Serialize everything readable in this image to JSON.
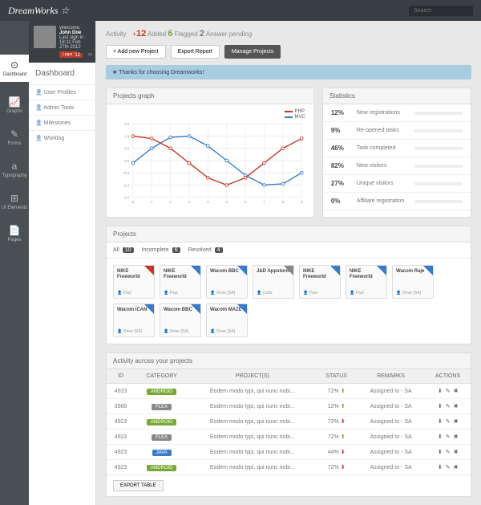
{
  "header": {
    "logo": "DreamWorks ☆",
    "search_placeholder": "Search"
  },
  "user": {
    "welcome": "Welcome,",
    "name": "John Doe",
    "last_signin": "Last sign in : 18:11 Feb 27th 2012",
    "logout": "Logout",
    "badge": "12"
  },
  "nav": [
    {
      "icon": "⊙",
      "label": "Dashboard"
    },
    {
      "icon": "📈",
      "label": "Graphs"
    },
    {
      "icon": "✎",
      "label": "Forms"
    },
    {
      "icon": "a",
      "label": "Typography"
    },
    {
      "icon": "⊞",
      "label": "UI Elements"
    },
    {
      "icon": "📄",
      "label": "Pages"
    }
  ],
  "menu": {
    "title": "Dashboard",
    "items": [
      "User Profiles",
      "Admin Tools",
      "Milestones",
      "Worklog"
    ]
  },
  "activity": {
    "label": "Activity",
    "stats": [
      {
        "prefix": "+",
        "num": "12",
        "text": "Added",
        "cls": "c-red"
      },
      {
        "prefix": "",
        "num": "6",
        "text": "Flagged",
        "cls": "c-green"
      },
      {
        "prefix": "",
        "num": "2",
        "text": "Answer pending",
        "cls": "c-gray"
      }
    ]
  },
  "buttons": {
    "add": "+  Add new Project",
    "export": "Export Report",
    "manage": "Manage Projects"
  },
  "notice": "★  Thanks for choosing Dreamworks!",
  "chart": {
    "title": "Projects graph",
    "legend": [
      {
        "name": "PHP",
        "color": "#c0392b"
      },
      {
        "name": "MVC",
        "color": "#3a7bc8"
      }
    ]
  },
  "chart_data": {
    "type": "line",
    "x": [
      0,
      1,
      2,
      3,
      4,
      5,
      6,
      7,
      8,
      9
    ],
    "ylim": [
      -1.5,
      1.5
    ],
    "series": [
      {
        "name": "MVC",
        "color": "#3a7bc8",
        "values": [
          -0.1,
          0.5,
          0.95,
          1.0,
          0.6,
          0.0,
          -0.6,
          -1.0,
          -0.95,
          -0.5
        ]
      },
      {
        "name": "PHP",
        "color": "#c0392b",
        "values": [
          1.0,
          0.9,
          0.5,
          -0.1,
          -0.7,
          -1.0,
          -0.7,
          -0.1,
          0.5,
          0.9
        ]
      }
    ]
  },
  "stats": {
    "title": "Statistics",
    "rows": [
      {
        "pct": "12%",
        "label": "New registrations",
        "val": 12
      },
      {
        "pct": "9%",
        "label": "Re-opened tasks",
        "val": 9
      },
      {
        "pct": "46%",
        "label": "Task completed",
        "val": 46
      },
      {
        "pct": "82%",
        "label": "New visitors",
        "val": 82
      },
      {
        "pct": "27%",
        "label": "Unique visitors",
        "val": 27
      },
      {
        "pct": "0%",
        "label": "Affiliate registration",
        "val": 0
      }
    ]
  },
  "projects": {
    "title": "Projects",
    "tabs": [
      {
        "label": "All",
        "count": "10"
      },
      {
        "label": "Incomplete",
        "count": "6"
      },
      {
        "label": "Resolved",
        "count": "4"
      }
    ],
    "cards": [
      {
        "title": "NIKE Freeworld",
        "user": "Paul",
        "corner": "red"
      },
      {
        "title": "NIKE Freeworld",
        "user": "Paul",
        "corner": "blue"
      },
      {
        "title": "Wacom BBC",
        "user": "Omar [SA]",
        "corner": "blue"
      },
      {
        "title": "J&D Appstorm",
        "user": "Carla",
        "corner": "gray"
      },
      {
        "title": "NIKE Freeworld",
        "user": "Paul",
        "corner": "blue"
      },
      {
        "title": "NIKE Freeworld",
        "user": "Paul",
        "corner": "blue"
      },
      {
        "title": "Wacom Raje",
        "user": "Omar [SA]",
        "corner": "blue"
      },
      {
        "title": "Wacom iCAN",
        "user": "Omar [SA]",
        "corner": "blue"
      },
      {
        "title": "Wacom BBC",
        "user": "Omar [SA]",
        "corner": "blue"
      },
      {
        "title": "Wacom MAZE",
        "user": "Omar [SA]",
        "corner": "blue"
      }
    ]
  },
  "table": {
    "title": "Activity across your projects",
    "headers": [
      "ID",
      "CATEGORY",
      "PROJECT(S)",
      "STATUS",
      "REMARKS",
      "ACTIONS"
    ],
    "rows": [
      {
        "id": "4923",
        "cat": "ANDROID",
        "catCls": "android",
        "proj": "Eodem modo typi, qui nunc nobi...",
        "status": "72%",
        "dir": "up",
        "remarks": "Assigned to - SA"
      },
      {
        "id": "3568",
        "cat": "FLEX",
        "catCls": "flex",
        "proj": "Eodem modo typi, qui nunc nobi...",
        "status": "12%",
        "dir": "up",
        "remarks": "Assigned to - SA"
      },
      {
        "id": "4923",
        "cat": "ANDROID",
        "catCls": "android",
        "proj": "Eodem modo typi, qui nunc nobi...",
        "status": "72%",
        "dir": "down",
        "remarks": "Assigned to - SA"
      },
      {
        "id": "4923",
        "cat": "FLEX",
        "catCls": "flex",
        "proj": "Eodem modo typi, qui nunc nobi...",
        "status": "72%",
        "dir": "up",
        "remarks": "Assigned to - SA"
      },
      {
        "id": "4923",
        "cat": "JAVA",
        "catCls": "java",
        "proj": "Eodem modo typi, qui nunc nobi...",
        "status": "44%",
        "dir": "down",
        "remarks": "Assigned to - SA"
      },
      {
        "id": "4923",
        "cat": "ANDROID",
        "catCls": "android",
        "proj": "Eodem modo typi, qui nunc nobi...",
        "status": "72%",
        "dir": "down",
        "remarks": "Assigned to - SA"
      }
    ],
    "export": "EXPORT TABLE"
  }
}
